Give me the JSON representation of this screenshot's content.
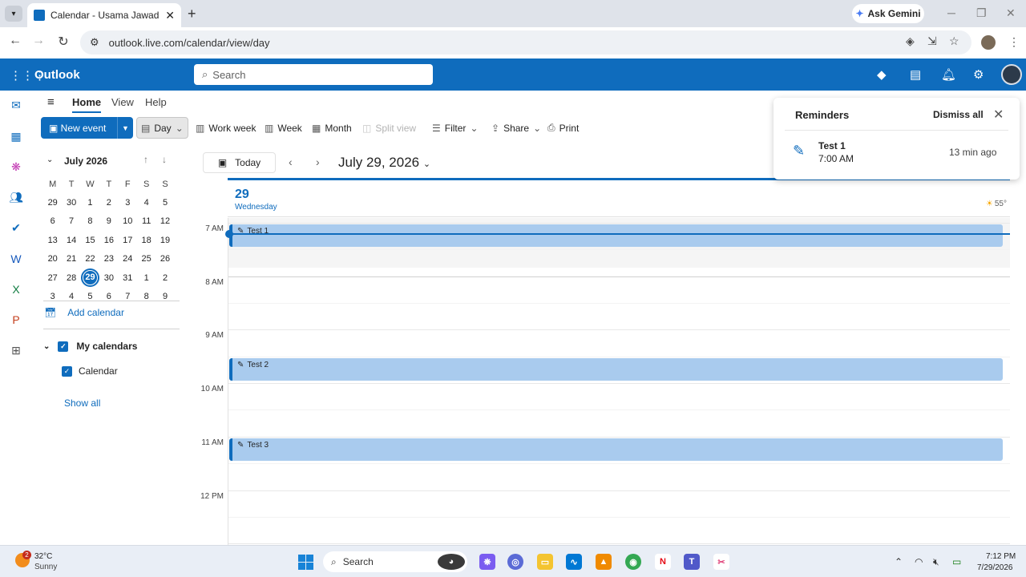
{
  "browser": {
    "tab_title": "Calendar - Usama Jawad - Outl",
    "new_tab": "+",
    "gemini_label": "Ask Gemini",
    "url": "outlook.live.com/calendar/view/day"
  },
  "header": {
    "brand": "Outlook",
    "search_placeholder": "Search"
  },
  "ribbon": {
    "tabs": [
      "Home",
      "View",
      "Help"
    ],
    "new_event": "New event",
    "views": [
      "Day",
      "Work week",
      "Week",
      "Month",
      "Split view"
    ],
    "filter": "Filter",
    "share": "Share",
    "print": "Print"
  },
  "minical": {
    "month_label": "July 2026",
    "weekdays": [
      "M",
      "T",
      "W",
      "T",
      "F",
      "S",
      "S"
    ],
    "weeks": [
      [
        "29",
        "30",
        "1",
        "2",
        "3",
        "4",
        "5"
      ],
      [
        "6",
        "7",
        "8",
        "9",
        "10",
        "11",
        "12"
      ],
      [
        "13",
        "14",
        "15",
        "16",
        "17",
        "18",
        "19"
      ],
      [
        "20",
        "21",
        "22",
        "23",
        "24",
        "25",
        "26"
      ],
      [
        "27",
        "28",
        "29",
        "30",
        "31",
        "1",
        "2"
      ],
      [
        "3",
        "4",
        "5",
        "6",
        "7",
        "8",
        "9"
      ]
    ],
    "selected_day": "29"
  },
  "sidebar": {
    "add_calendar": "Add calendar",
    "my_calendars": "My calendars",
    "calendar_item": "Calendar",
    "show_all": "Show all"
  },
  "calendar": {
    "today_button": "Today",
    "date_title": "July 29, 2026",
    "day_number": "29",
    "day_name": "Wednesday",
    "weather_temp": "55°",
    "time_labels": [
      "7 AM",
      "8 AM",
      "9 AM",
      "10 AM",
      "11 AM",
      "12 PM"
    ],
    "events": [
      {
        "title": "Test 1",
        "start_hour": 7.0
      },
      {
        "title": "Test 2",
        "start_hour": 9.5
      },
      {
        "title": "Test 3",
        "start_hour": 11.0
      }
    ]
  },
  "reminders": {
    "title": "Reminders",
    "dismiss_all": "Dismiss all",
    "item_title": "Test 1",
    "item_time": "7:00 AM",
    "item_ago": "13 min ago"
  },
  "taskbar": {
    "weather_badge": "2",
    "temperature": "32°C",
    "condition": "Sunny",
    "search": "Search",
    "time": "7:12 PM",
    "date": "7/29/2026"
  }
}
